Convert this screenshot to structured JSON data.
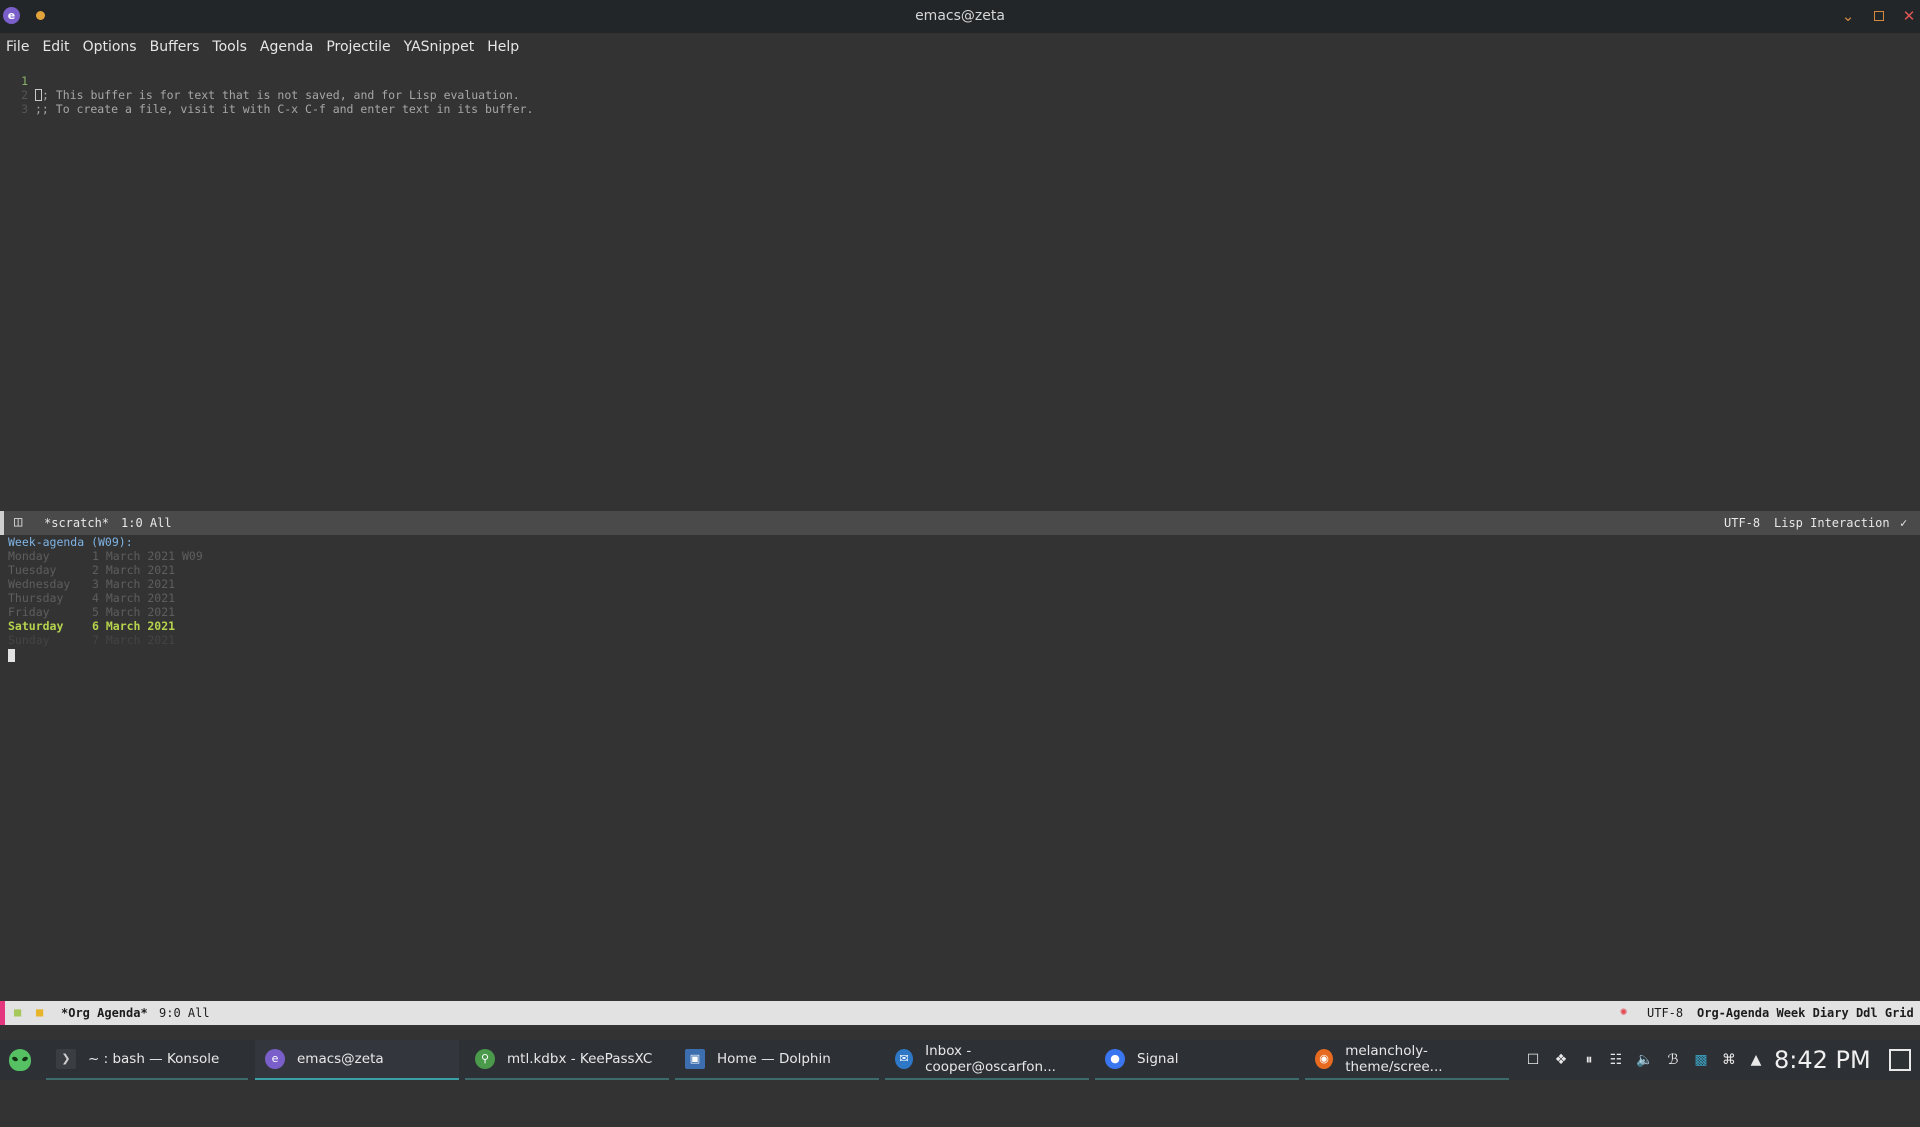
{
  "window": {
    "title": "emacs@zeta"
  },
  "menu": [
    "File",
    "Edit",
    "Options",
    "Buffers",
    "Tools",
    "Agenda",
    "Projectile",
    "YASnippet",
    "Help"
  ],
  "scratch": {
    "lines": [
      {
        "num": "1",
        "text": "; This buffer is for text that is not saved, and for Lisp evaluation."
      },
      {
        "num": "2",
        "text": ";; To create a file, visit it with C-x C-f and enter text in its buffer."
      },
      {
        "num": "3",
        "text": ""
      }
    ]
  },
  "modeline_top": {
    "buffer": "*scratch*",
    "position": "1:0 All",
    "encoding": "UTF-8",
    "mode": "Lisp Interaction",
    "check": "✓"
  },
  "agenda": {
    "header": "Week-agenda (W09):",
    "days": [
      {
        "name": "Monday",
        "date": "1 March 2021 W09"
      },
      {
        "name": "Tuesday",
        "date": "2 March 2021"
      },
      {
        "name": "Wednesday",
        "date": "3 March 2021"
      },
      {
        "name": "Thursday",
        "date": "4 March 2021"
      },
      {
        "name": "Friday",
        "date": "5 March 2021"
      },
      {
        "name": "Saturday",
        "date": "6 March 2021"
      },
      {
        "name": "Sunday",
        "date": "7 March 2021"
      }
    ]
  },
  "modeline_bottom": {
    "buffer": "*Org Agenda*",
    "position": "9:0 All",
    "encoding": "UTF-8",
    "mode": "Org-Agenda Week Diary Ddl Grid"
  },
  "taskbar": {
    "tasks": [
      {
        "label": "~ : bash — Konsole",
        "icon": "terminal-icon",
        "color": "#3a3d42"
      },
      {
        "label": "emacs@zeta",
        "icon": "emacs-icon",
        "color": "#7a5ec9"
      },
      {
        "label": "mtl.kdbx - KeePassXC",
        "icon": "keepassxc-icon",
        "color": "#4b9a4b"
      },
      {
        "label": "Home — Dolphin",
        "icon": "folder-icon",
        "color": "#3d6fb0"
      },
      {
        "label": "Inbox - cooper@oscarfon...",
        "icon": "mail-icon",
        "color": "#2f78c8"
      },
      {
        "label": "Signal",
        "icon": "signal-icon",
        "color": "#3a76f0"
      },
      {
        "label": "melancholy-theme/scree...",
        "icon": "firefox-icon",
        "color": "#e66a1f"
      }
    ],
    "clock": "8:42 PM"
  }
}
